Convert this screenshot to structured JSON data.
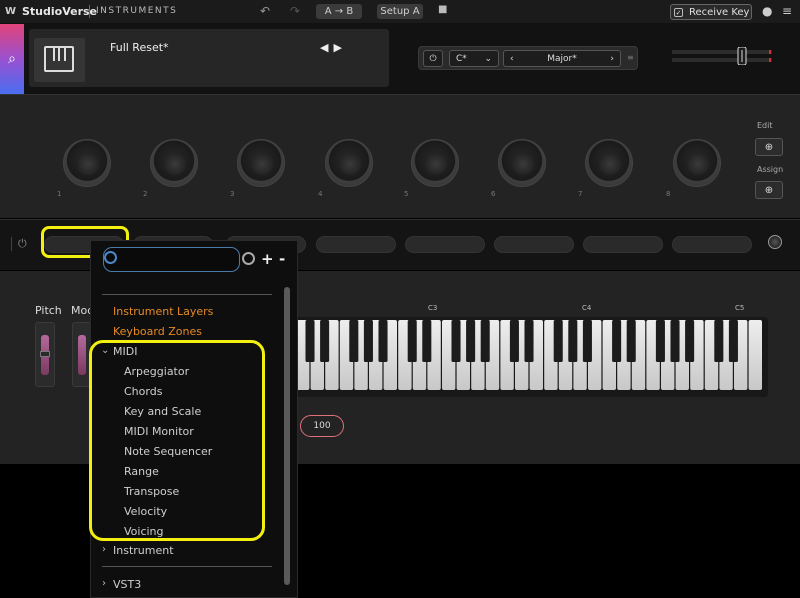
{
  "topbar": {
    "brand": "StudioVerse",
    "section": "INSTRUMENTS",
    "ab_label": "A → B",
    "setup_label": "Setup A",
    "receive_key_label": "Receive Key"
  },
  "preset": {
    "name": "Full Reset*",
    "root_key": "C*",
    "scale": "Major*"
  },
  "macros": {
    "numbers": [
      "1",
      "2",
      "3",
      "4",
      "5",
      "6",
      "7",
      "8"
    ],
    "edit_label": "Edit",
    "assign_label": "Assign"
  },
  "performance": {
    "pitch_label": "Pitch",
    "mod_label": "Mod",
    "octave_labels": [
      "C3",
      "C4",
      "C5"
    ],
    "velocity_value": "100"
  },
  "dropdown": {
    "categories": [
      "Instrument Layers",
      "Keyboard Zones"
    ],
    "midi_group": "MIDI",
    "midi_items": [
      "Arpeggiator",
      "Chords",
      "Key and Scale",
      "MIDI Monitor",
      "Note Sequencer",
      "Range",
      "Transpose",
      "Velocity",
      "Voicing"
    ],
    "instrument_group": "Instrument",
    "vst3_group": "VST3",
    "add_label": "+",
    "remove_label": "-"
  },
  "colors": {
    "accent_orange": "#e58a26",
    "highlight_yellow": "#f3ef0e",
    "search_border": "#4a7aa8"
  }
}
